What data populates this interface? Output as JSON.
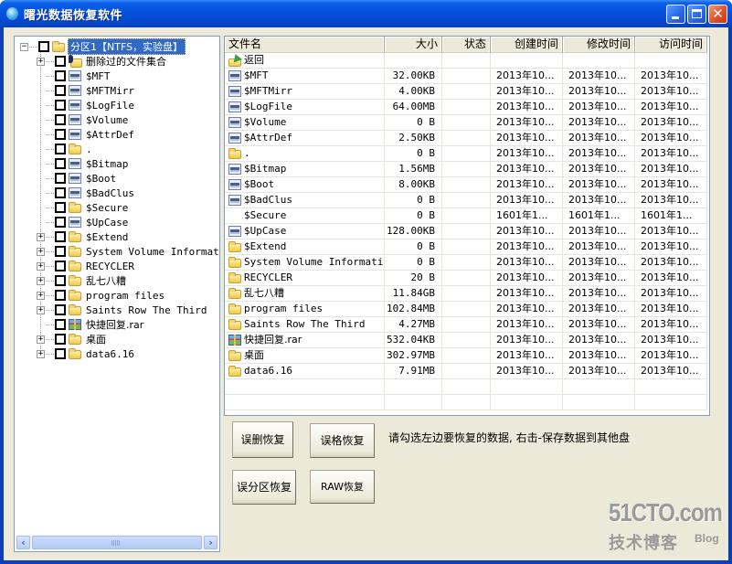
{
  "window": {
    "title": "曙光数据恢复软件",
    "controls": {
      "minimize": "_",
      "maximize": "□",
      "close": "✕"
    }
  },
  "tree": {
    "root": {
      "label": "分区1【NTFS，实验盘】",
      "expander": "−",
      "selected": true
    },
    "items": [
      {
        "label": "删除过的文件集合",
        "icon": "deleted-folder-icon",
        "expander": "+",
        "cjk": true
      },
      {
        "label": "$MFT",
        "icon": "system-file-icon",
        "expander": ""
      },
      {
        "label": "$MFTMirr",
        "icon": "system-file-icon",
        "expander": ""
      },
      {
        "label": "$LogFile",
        "icon": "system-file-icon",
        "expander": ""
      },
      {
        "label": "$Volume",
        "icon": "system-file-icon",
        "expander": ""
      },
      {
        "label": "$AttrDef",
        "icon": "system-file-icon",
        "expander": ""
      },
      {
        "label": ".",
        "icon": "folder-icon",
        "expander": ""
      },
      {
        "label": "$Bitmap",
        "icon": "system-file-icon",
        "expander": ""
      },
      {
        "label": "$Boot",
        "icon": "system-file-icon",
        "expander": ""
      },
      {
        "label": "$BadClus",
        "icon": "system-file-icon",
        "expander": ""
      },
      {
        "label": "$Secure",
        "icon": "folder-icon",
        "expander": ""
      },
      {
        "label": "$UpCase",
        "icon": "system-file-icon",
        "expander": ""
      },
      {
        "label": "$Extend",
        "icon": "folder-icon",
        "expander": "+"
      },
      {
        "label": "System Volume Information",
        "icon": "folder-icon",
        "expander": "+"
      },
      {
        "label": "RECYCLER",
        "icon": "folder-icon",
        "expander": "+"
      },
      {
        "label": "乱七八糟",
        "icon": "folder-icon",
        "expander": "+",
        "cjk": true
      },
      {
        "label": "program files",
        "icon": "folder-icon",
        "expander": "+"
      },
      {
        "label": "Saints Row The Third",
        "icon": "folder-icon",
        "expander": "+"
      },
      {
        "label": "快捷回复.rar",
        "icon": "rar-archive-icon",
        "expander": "",
        "cjk": true
      },
      {
        "label": "桌面",
        "icon": "folder-icon",
        "expander": "+",
        "cjk": true
      },
      {
        "label": "data6.16",
        "icon": "folder-icon",
        "expander": "+"
      }
    ],
    "scrollbar": {
      "left_arrow": "‹",
      "right_arrow": "›"
    }
  },
  "list": {
    "columns": [
      "文件名",
      "大小",
      "状态",
      "创建时间",
      "修改时间",
      "访问时间"
    ],
    "rows": [
      {
        "name": "返回",
        "icon": "back-icon",
        "size": "",
        "status": "",
        "created": "",
        "modified": "",
        "accessed": "",
        "cjk": true
      },
      {
        "name": "$MFT",
        "icon": "system-file-icon",
        "size": "32.00KB",
        "status": "",
        "created": "2013年10...",
        "modified": "2013年10...",
        "accessed": "2013年10..."
      },
      {
        "name": "$MFTMirr",
        "icon": "system-file-icon",
        "size": "4.00KB",
        "status": "",
        "created": "2013年10...",
        "modified": "2013年10...",
        "accessed": "2013年10..."
      },
      {
        "name": "$LogFile",
        "icon": "system-file-icon",
        "size": "64.00MB",
        "status": "",
        "created": "2013年10...",
        "modified": "2013年10...",
        "accessed": "2013年10..."
      },
      {
        "name": "$Volume",
        "icon": "system-file-icon",
        "size": "0 B",
        "status": "",
        "created": "2013年10...",
        "modified": "2013年10...",
        "accessed": "2013年10..."
      },
      {
        "name": "$AttrDef",
        "icon": "system-file-icon",
        "size": "2.50KB",
        "status": "",
        "created": "2013年10...",
        "modified": "2013年10...",
        "accessed": "2013年10..."
      },
      {
        "name": ".",
        "icon": "folder-icon",
        "size": "0 B",
        "status": "",
        "created": "2013年10...",
        "modified": "2013年10...",
        "accessed": "2013年10..."
      },
      {
        "name": "$Bitmap",
        "icon": "system-file-icon",
        "size": "1.56MB",
        "status": "",
        "created": "2013年10...",
        "modified": "2013年10...",
        "accessed": "2013年10..."
      },
      {
        "name": "$Boot",
        "icon": "system-file-icon",
        "size": "8.00KB",
        "status": "",
        "created": "2013年10...",
        "modified": "2013年10...",
        "accessed": "2013年10..."
      },
      {
        "name": "$BadClus",
        "icon": "system-file-icon",
        "size": "0 B",
        "status": "",
        "created": "2013年10...",
        "modified": "2013年10...",
        "accessed": "2013年10..."
      },
      {
        "name": "$Secure",
        "icon": "",
        "size": "0 B",
        "status": "",
        "created": "1601年1...",
        "modified": "1601年1...",
        "accessed": "1601年1..."
      },
      {
        "name": "$UpCase",
        "icon": "system-file-icon",
        "size": "128.00KB",
        "status": "",
        "created": "2013年10...",
        "modified": "2013年10...",
        "accessed": "2013年10..."
      },
      {
        "name": "$Extend",
        "icon": "folder-icon",
        "size": "0 B",
        "status": "",
        "created": "2013年10...",
        "modified": "2013年10...",
        "accessed": "2013年10..."
      },
      {
        "name": "System Volume Information",
        "icon": "folder-icon",
        "size": "0 B",
        "status": "",
        "created": "2013年10...",
        "modified": "2013年10...",
        "accessed": "2013年10..."
      },
      {
        "name": "RECYCLER",
        "icon": "folder-icon",
        "size": "20 B",
        "status": "",
        "created": "2013年10...",
        "modified": "2013年10...",
        "accessed": "2013年10..."
      },
      {
        "name": "乱七八糟",
        "icon": "folder-icon",
        "size": "11.84GB",
        "status": "",
        "created": "2013年10...",
        "modified": "2013年10...",
        "accessed": "2013年10...",
        "cjk": true
      },
      {
        "name": "program files",
        "icon": "folder-icon",
        "size": "102.84MB",
        "status": "",
        "created": "2013年10...",
        "modified": "2013年10...",
        "accessed": "2013年10..."
      },
      {
        "name": "Saints Row The Third",
        "icon": "folder-icon",
        "size": "4.27MB",
        "status": "",
        "created": "2013年10...",
        "modified": "2013年10...",
        "accessed": "2013年10..."
      },
      {
        "name": "快捷回复.rar",
        "icon": "rar-archive-icon",
        "size": "532.04KB",
        "status": "",
        "created": "2013年10...",
        "modified": "2013年10...",
        "accessed": "2013年10...",
        "cjk": true
      },
      {
        "name": "桌面",
        "icon": "folder-icon",
        "size": "302.97MB",
        "status": "",
        "created": "2013年10...",
        "modified": "2013年10...",
        "accessed": "2013年10...",
        "cjk": true
      },
      {
        "name": "data6.16",
        "icon": "folder-icon",
        "size": "7.91MB",
        "status": "",
        "created": "2013年10...",
        "modified": "2013年10...",
        "accessed": "2013年10..."
      }
    ]
  },
  "actions": {
    "undelete": "误删恢复",
    "unformat": "误格恢复",
    "partition_recovery": "误分区恢复",
    "raw_recovery": "RAW恢复",
    "hint": "请勾选左边要恢复的数据, 右击-保存数据到其他盘"
  },
  "watermark": {
    "site": "51CTO.com",
    "subtitle": "技术博客",
    "blog": "Blog"
  },
  "colors": {
    "titlebar": "#0550dc",
    "selection": "#316ac5",
    "face": "#ece9d8",
    "border": "#7f9db9"
  }
}
